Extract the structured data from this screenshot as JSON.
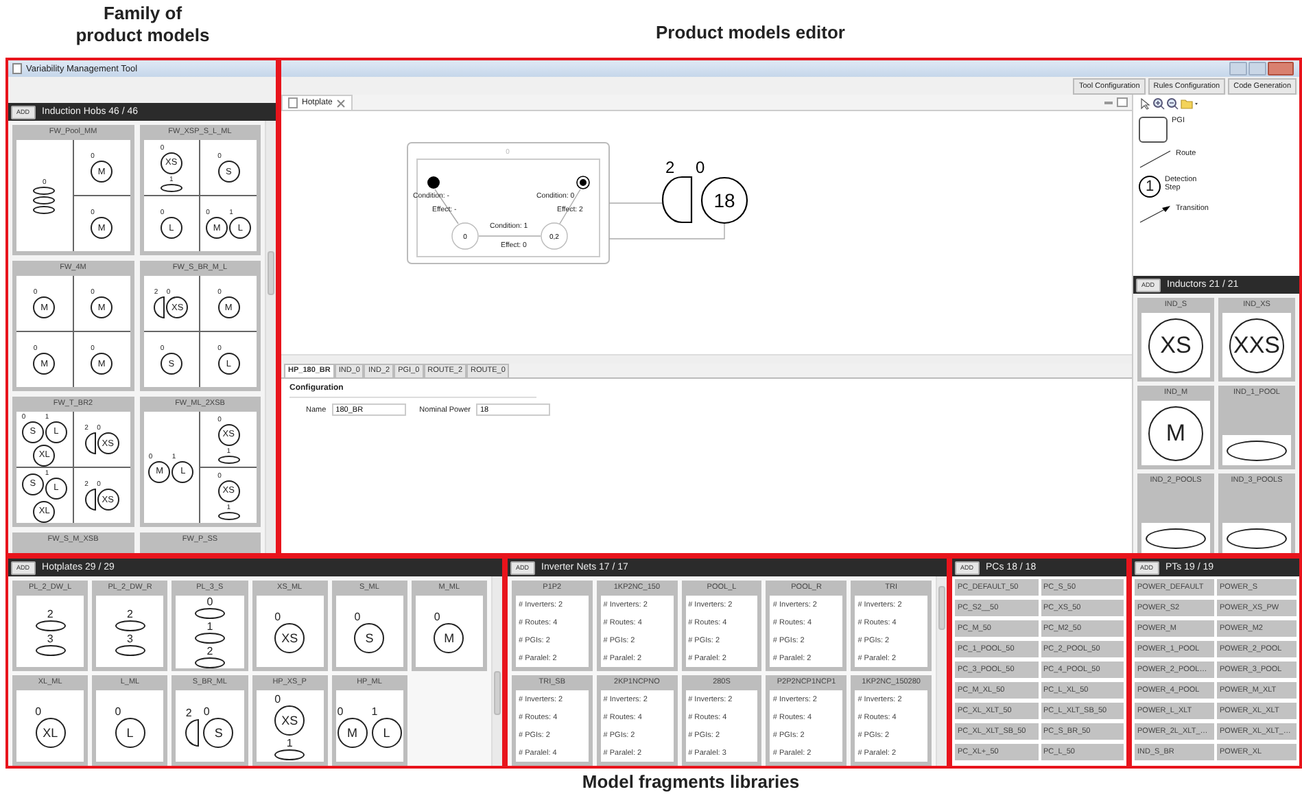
{
  "captions": {
    "left": "Family of product models",
    "top": "Product models editor",
    "bottom": "Model fragments libraries"
  },
  "window": {
    "title": "Variability Management Tool"
  },
  "toolbar": {
    "buttons": [
      "Tool Configuration",
      "Rules Configuration",
      "Code Generation"
    ]
  },
  "hobs": {
    "add": "ADD",
    "title": "Induction Hobs 46 / 46",
    "tiles": [
      {
        "name": "FW_Pool_MM",
        "kind": "split",
        "zones": [
          [
            {
              "kind": "oval",
              "number": "0"
            },
            {
              "kind": "oval"
            },
            {
              "kind": "oval"
            }
          ],
          [
            {
              "kind": "circle",
              "label": "M",
              "number": "0"
            }
          ],
          [
            {
              "kind": "circle",
              "label": "M",
              "number": "0"
            }
          ]
        ]
      },
      {
        "name": "FW_XSP_S_L_ML",
        "kind": "quad",
        "zones": [
          [
            {
              "kind": "circle",
              "label": "XS",
              "number": "0"
            },
            {
              "kind": "oval",
              "number": "1"
            }
          ],
          [
            {
              "kind": "circle",
              "label": "S",
              "number": "0"
            }
          ],
          [
            {
              "kind": "circle",
              "label": "L",
              "number": "0"
            }
          ],
          [
            {
              "kind": "circle",
              "label": "M",
              "number": "0"
            },
            {
              "kind": "circle",
              "label": "L",
              "number": "1"
            }
          ]
        ]
      },
      {
        "name": "FW_4M",
        "kind": "quad",
        "zones": [
          [
            {
              "kind": "circle",
              "label": "M",
              "number": "0"
            }
          ],
          [
            {
              "kind": "circle",
              "label": "M",
              "number": "0"
            }
          ],
          [
            {
              "kind": "circle",
              "label": "M",
              "number": "0"
            }
          ],
          [
            {
              "kind": "circle",
              "label": "M",
              "number": "0"
            }
          ]
        ]
      },
      {
        "name": "FW_S_BR_M_L",
        "kind": "quad",
        "zones": [
          [
            {
              "kind": "half",
              "number": "2"
            },
            {
              "kind": "circle",
              "label": "XS",
              "number": "0"
            }
          ],
          [
            {
              "kind": "circle",
              "label": "M",
              "number": "0"
            }
          ],
          [
            {
              "kind": "circle",
              "label": "S",
              "number": "0"
            }
          ],
          [
            {
              "kind": "circle",
              "label": "L",
              "number": "0"
            }
          ]
        ]
      },
      {
        "name": "FW_T_BR2",
        "kind": "quad",
        "zones": [
          [
            {
              "kind": "circle",
              "label": "S",
              "number": "0"
            },
            {
              "kind": "circle",
              "label": "L",
              "number": "1"
            },
            {
              "kind": "circle",
              "label": "XL"
            }
          ],
          [
            {
              "kind": "half",
              "number": "2"
            },
            {
              "kind": "circle",
              "label": "XS",
              "number": "0"
            }
          ],
          [
            {
              "kind": "circle",
              "label": "S"
            },
            {
              "kind": "circle",
              "label": "L",
              "number": "1"
            },
            {
              "kind": "circle",
              "label": "XL"
            }
          ],
          [
            {
              "kind": "half",
              "number": "2"
            },
            {
              "kind": "circle",
              "label": "XS",
              "number": "0"
            }
          ]
        ]
      },
      {
        "name": "FW_ML_2XSB",
        "kind": "split",
        "zones": [
          [
            {
              "kind": "circle",
              "label": "M",
              "number": "0"
            },
            {
              "kind": "circle",
              "label": "L",
              "number": "1"
            }
          ],
          [
            {
              "kind": "circle",
              "label": "XS",
              "number": "0"
            },
            {
              "kind": "oval",
              "number": "1"
            }
          ],
          [
            {
              "kind": "circle",
              "label": "XS",
              "number": "0"
            },
            {
              "kind": "oval",
              "number": "1"
            }
          ]
        ]
      },
      {
        "name": "FW_S_M_XSB"
      },
      {
        "name": "FW_P_SS"
      }
    ]
  },
  "editor": {
    "tab": "Hotplate",
    "diagram": {
      "box_title": "0",
      "states": [
        "0",
        "0,2"
      ],
      "transitions": [
        {
          "condition": "Condition: -",
          "effect": "Effect: -"
        },
        {
          "condition": "Condition: 0",
          "effect": "Effect: 2"
        },
        {
          "condition": "Condition: 1",
          "effect": "Effect: 0"
        }
      ],
      "hob": {
        "half_number": "2",
        "circle_number": "0",
        "circle_label": "18"
      }
    },
    "property_tabs": [
      {
        "label": "HP_180_BR",
        "selected": true
      },
      {
        "label": "IND_0",
        "selected": false
      },
      {
        "label": "IND_2",
        "selected": false
      },
      {
        "label": "PGI_0",
        "selected": false
      },
      {
        "label": "ROUTE_2",
        "selected": false
      },
      {
        "label": "ROUTE_0",
        "selected": false
      }
    ],
    "section": "Configuration",
    "fields": [
      {
        "label": "Name",
        "value": "180_BR"
      },
      {
        "label": "Nominal Power",
        "value": "18"
      }
    ]
  },
  "palette": {
    "items": [
      {
        "kind": "pgi",
        "label": "PGI"
      },
      {
        "kind": "route",
        "label": "Route"
      },
      {
        "kind": "step",
        "label": "Detection Step",
        "symbol": "1"
      },
      {
        "kind": "transition",
        "label": "Transition"
      }
    ]
  },
  "inductors": {
    "add": "ADD",
    "title": "Inductors 21 / 21",
    "tiles": [
      {
        "name": "IND_S",
        "kind": "circle",
        "label": "XS"
      },
      {
        "name": "IND_XS",
        "kind": "circle",
        "label": "XXS"
      },
      {
        "name": "IND_M",
        "kind": "circle",
        "label": "M"
      },
      {
        "name": "IND_1_POOL",
        "kind": "oval"
      },
      {
        "name": "IND_2_POOLS",
        "kind": "oval"
      },
      {
        "name": "IND_3_POOLS",
        "kind": "oval"
      }
    ]
  },
  "hotplates": {
    "add": "ADD",
    "title": "Hotplates 29 / 29",
    "tiles": [
      {
        "name": "PL_2_DW_L",
        "items": [
          {
            "kind": "oval",
            "number": "2"
          },
          {
            "kind": "oval",
            "number": "3"
          }
        ]
      },
      {
        "name": "PL_2_DW_R",
        "items": [
          {
            "kind": "oval",
            "number": "2"
          },
          {
            "kind": "oval",
            "number": "3"
          }
        ]
      },
      {
        "name": "PL_3_S",
        "items": [
          {
            "kind": "oval",
            "number": "0"
          },
          {
            "kind": "oval",
            "number": "1"
          },
          {
            "kind": "oval",
            "number": "2"
          }
        ]
      },
      {
        "name": "XS_ML",
        "items": [
          {
            "kind": "circle",
            "label": "XS",
            "number": "0"
          }
        ]
      },
      {
        "name": "S_ML",
        "items": [
          {
            "kind": "circle",
            "label": "S",
            "number": "0"
          }
        ]
      },
      {
        "name": "M_ML",
        "items": [
          {
            "kind": "circle",
            "label": "M",
            "number": "0"
          }
        ]
      },
      {
        "name": "XL_ML",
        "items": [
          {
            "kind": "circle",
            "label": "XL",
            "number": "0"
          }
        ]
      },
      {
        "name": "L_ML",
        "items": [
          {
            "kind": "circle",
            "label": "L",
            "number": "0"
          }
        ]
      },
      {
        "name": "S_BR_ML",
        "items": [
          {
            "kind": "half",
            "number": "2"
          },
          {
            "kind": "circle",
            "label": "S",
            "number": "0"
          }
        ]
      },
      {
        "name": "HP_XS_P",
        "items": [
          {
            "kind": "circle",
            "label": "XS",
            "number": "0"
          },
          {
            "kind": "oval",
            "number": "1"
          }
        ]
      },
      {
        "name": "HP_ML",
        "items": [
          {
            "kind": "circle",
            "label": "M",
            "number": "0"
          },
          {
            "kind": "circle",
            "label": "L",
            "number": "1"
          }
        ]
      }
    ]
  },
  "inverter_nets": {
    "add": "ADD",
    "title": "Inverter Nets 17 / 17",
    "tiles": [
      {
        "name": "P1P2",
        "lines": [
          "# Inverters: 2",
          "# Routes: 4",
          "# PGIs: 2",
          "# Paralel: 2"
        ]
      },
      {
        "name": "1KP2NC_150",
        "lines": [
          "# Inverters: 2",
          "# Routes: 4",
          "# PGIs: 2",
          "# Paralel: 2"
        ]
      },
      {
        "name": "POOL_L",
        "lines": [
          "# Inverters: 2",
          "# Routes: 4",
          "# PGIs: 2",
          "# Paralel: 2"
        ]
      },
      {
        "name": "POOL_R",
        "lines": [
          "# Inverters: 2",
          "# Routes: 4",
          "# PGIs: 2",
          "# Paralel: 2"
        ]
      },
      {
        "name": "TRI",
        "lines": [
          "# Inverters: 2",
          "# Routes: 4",
          "# PGIs: 2",
          "# Paralel: 2"
        ]
      },
      {
        "name": "TRI_SB",
        "lines": [
          "# Inverters: 2",
          "# Routes: 4",
          "# PGIs: 2",
          "# Paralel: 4"
        ]
      },
      {
        "name": "2KP1NCPNO",
        "lines": [
          "# Inverters: 2",
          "# Routes: 4",
          "# PGIs: 2",
          "# Paralel: 2"
        ]
      },
      {
        "name": "280S",
        "lines": [
          "# Inverters: 2",
          "# Routes: 4",
          "# PGIs: 2",
          "# Paralel: 3"
        ]
      },
      {
        "name": "P2P2NCP1NCP1",
        "lines": [
          "# Inverters: 2",
          "# Routes: 4",
          "# PGIs: 2",
          "# Paralel: 2"
        ]
      },
      {
        "name": "1KP2NC_150280",
        "lines": [
          "# Inverters: 2",
          "# Routes: 4",
          "# PGIs: 2",
          "# Paralel: 2"
        ]
      }
    ]
  },
  "pcs": {
    "add": "ADD",
    "title": "PCs 18 / 18",
    "items": [
      "PC_DEFAULT_50",
      "PC_S_50",
      "PC_S2__50",
      "PC_XS_50",
      "PC_M_50",
      "PC_M2_50",
      "PC_1_POOL_50",
      "PC_2_POOL_50",
      "PC_3_POOL_50",
      "PC_4_POOL_50",
      "PC_M_XL_50",
      "PC_L_XL_50",
      "PC_XL_XLT_50",
      "PC_L_XLT_SB_50",
      "PC_XL_XLT_SB_50",
      "PC_S_BR_50",
      "PC_XL+_50",
      "PC_L_50"
    ]
  },
  "pts": {
    "add": "ADD",
    "title": "PTs 19 / 19",
    "items": [
      "POWER_DEFAULT",
      "POWER_S",
      "POWER_S2",
      "POWER_XS_PW",
      "POWER_M",
      "POWER_M2",
      "POWER_1_POOL",
      "POWER_2_POOL",
      "POWER_2_POOL…",
      "POWER_3_POOL",
      "POWER_4_POOL",
      "POWER_M_XLT",
      "POWER_L_XLT",
      "POWER_XL_XLT",
      "POWER_2L_XLT_…",
      "POWER_XL_XLT_…",
      "IND_S_BR",
      "POWER_XL"
    ]
  }
}
